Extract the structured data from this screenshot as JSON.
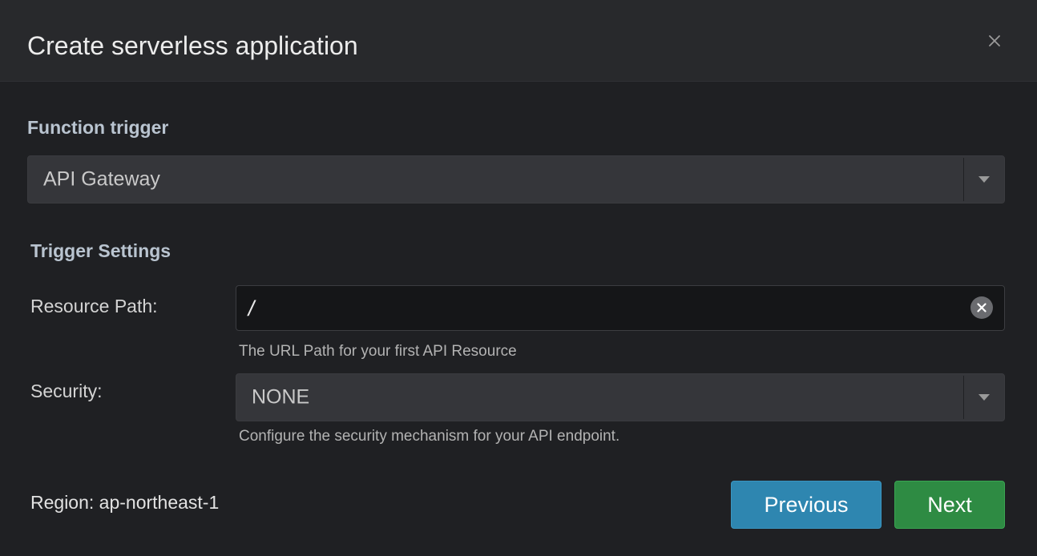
{
  "dialog": {
    "title": "Create serverless application"
  },
  "function_trigger": {
    "label": "Function trigger",
    "selected": "API Gateway"
  },
  "trigger_settings": {
    "heading": "Trigger Settings",
    "resource_path": {
      "label": "Resource Path:",
      "value": "/",
      "help": "The URL Path for your first API Resource"
    },
    "security": {
      "label": "Security:",
      "selected": "NONE",
      "help": "Configure the security mechanism for your API endpoint."
    }
  },
  "footer": {
    "region_label": "Region: ap-northeast-1",
    "previous_label": "Previous",
    "next_label": "Next"
  },
  "icons": {
    "close": "close-icon",
    "dropdown": "chevron-down-icon",
    "clear": "clear-circle-icon"
  },
  "colors": {
    "previous_button": "#2e86b0",
    "next_button": "#2e8b43",
    "section_label": "#b9c4d0"
  }
}
